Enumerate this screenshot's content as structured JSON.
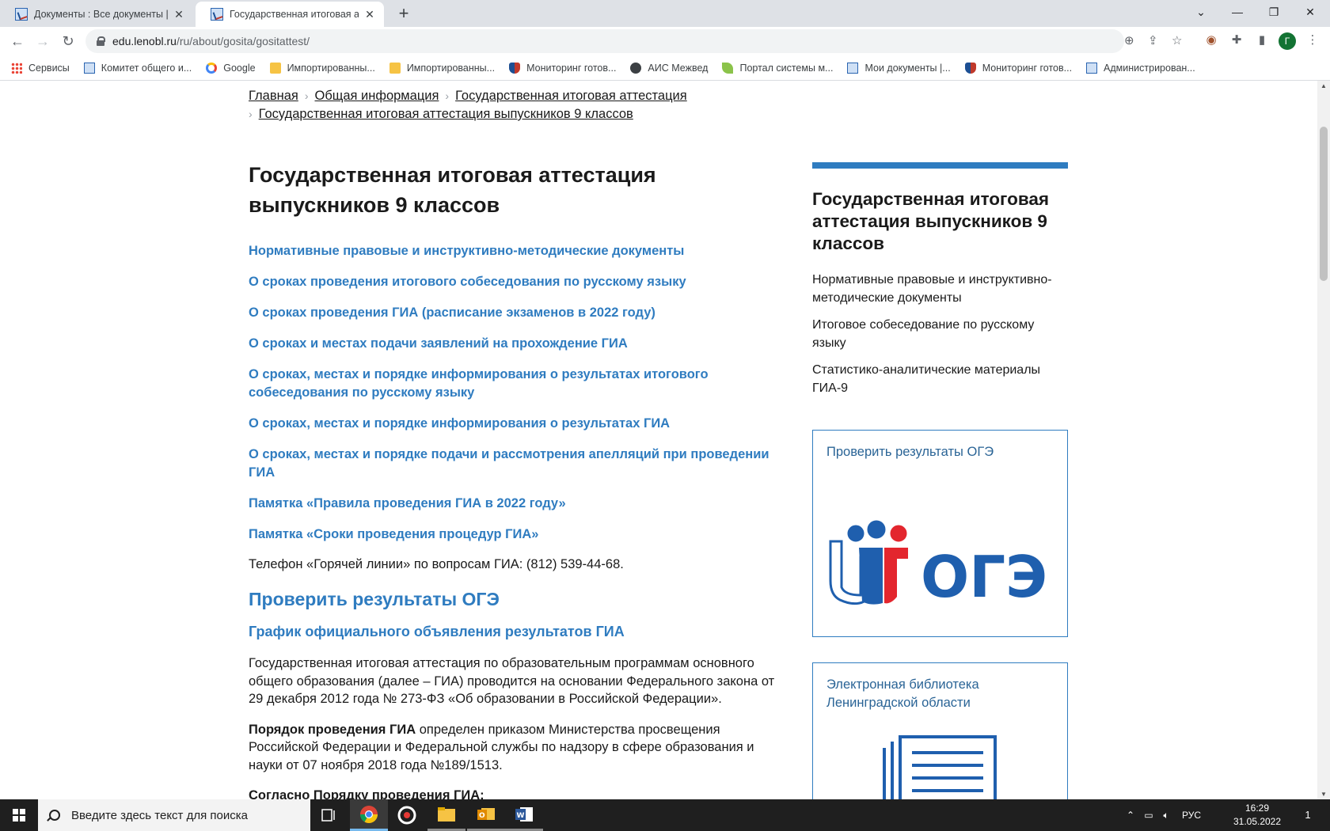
{
  "browser": {
    "tabs": [
      {
        "title": "Документы : Все документы | Эл",
        "active": false
      },
      {
        "title": "Государственная итоговая аттес",
        "active": true
      }
    ],
    "address": {
      "host": "edu.lenobl.ru",
      "path": "/ru/about/gosita/gositattest/"
    },
    "profile_initial": "Г",
    "bookmarks": [
      {
        "label": "Сервисы",
        "icon": "apps-icon"
      },
      {
        "label": "Комитет общего и...",
        "icon": "site-icon"
      },
      {
        "label": "Google",
        "icon": "google-icon"
      },
      {
        "label": "Импортированны...",
        "icon": "folder-icon"
      },
      {
        "label": "Импортированны...",
        "icon": "folder-icon"
      },
      {
        "label": "Мониторинг готов...",
        "icon": "shield-icon"
      },
      {
        "label": "АИС Межвед",
        "icon": "globe-icon"
      },
      {
        "label": "Портал системы м...",
        "icon": "leaf-icon"
      },
      {
        "label": "Мои документы |...",
        "icon": "site-icon"
      },
      {
        "label": "Мониторинг готов...",
        "icon": "shield-icon"
      },
      {
        "label": "Администрирован...",
        "icon": "site-icon"
      }
    ]
  },
  "breadcrumbs": [
    "Главная",
    "Общая информация",
    "Государственная итоговая аттестация",
    "Государственная итоговая аттестация выпускников 9 классов"
  ],
  "main": {
    "title": "Государственная итоговая аттестация выпускников 9 классов",
    "links": [
      "Нормативные правовые и инструктивно-методические документы",
      "О сроках проведения итогового собеседования по русскому языку",
      "О сроках проведения ГИА (расписание экзаменов в 2022 году)",
      "О сроках и местах подачи заявлений на прохождение ГИА",
      "О сроках, местах и порядке информирования о результатах итогового собеседования по русскому языку",
      "О сроках, местах и порядке информирования о результатах ГИА",
      "О сроках, местах и порядке подачи и рассмотрения апелляций при проведении ГИА",
      "Памятка «Правила проведения ГИА в 2022 году»",
      "Памятка «Сроки проведения процедур ГИА»"
    ],
    "phone": "Телефон «Горячей линии» по вопросам ГИА: (812) 539-44-68.",
    "check_results": "Проверить результаты ОГЭ",
    "schedule": "График официального объявления результатов ГИА",
    "para1": "Государственная итоговая аттестация по образовательным программам основного общего образования (далее – ГИА) проводится на основании Федерального закона от 29 декабря 2012 года № 273-ФЗ «Об образовании в Российской Федерации».",
    "para2_bold": "Порядок проведения ГИА",
    "para2_rest": " определен приказом Министерства просвещения Российской Федерации и Федеральной службы по надзору в сфере образования и науки от 07 ноября 2018 года №189/1513.",
    "para3_bold": "Согласно Порядку проведения ГИА:"
  },
  "sidebar": {
    "title": "Государственная итоговая аттестация выпускников 9 классов",
    "links": [
      "Нормативные правовые и инструктивно-методические документы",
      "Итоговое собеседование по русскому языку",
      "Статистико-аналитические материалы ГИА-9"
    ],
    "card1_title": "Проверить результаты ОГЭ",
    "card1_logo_text": "ОГЭ",
    "card2_title": "Электронная библиотека Ленинградской области"
  },
  "taskbar": {
    "search_placeholder": "Введите здесь текст для поиска",
    "lang": "РУС",
    "time": "16:29",
    "date": "31.05.2022",
    "notifications": "1"
  },
  "colors": {
    "link": "#2f7cc0",
    "accent_bar": "#2f7cc0",
    "oge_blue": "#1f5fae",
    "oge_red": "#e3262e"
  }
}
